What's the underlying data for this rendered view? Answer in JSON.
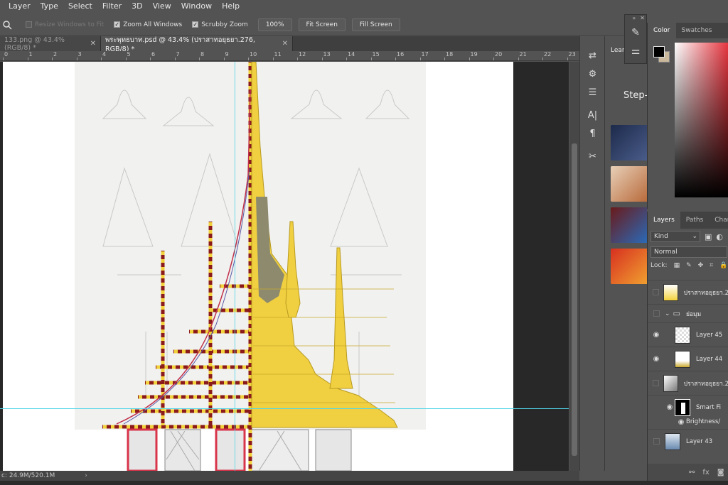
{
  "menu": [
    "Layer",
    "Type",
    "Select",
    "Filter",
    "3D",
    "View",
    "Window",
    "Help"
  ],
  "options": {
    "resize_windows": "Resize Windows to Fit",
    "zoom_all": "Zoom All Windows",
    "scrubby": "Scrubby Zoom",
    "zoom_value": "100%",
    "fit_screen": "Fit Screen",
    "fill_screen": "Fill Screen"
  },
  "tabs": [
    {
      "label": "133.png @ 43.4% (RGB/8) *",
      "active": false
    },
    {
      "label": "พระพุทธบาท.psd @ 43.4% (ปราสาทอยุธยา.276, RGB/8) *",
      "active": true
    }
  ],
  "ruler_ticks": [
    "0",
    "1",
    "2",
    "3",
    "4",
    "5",
    "6",
    "7",
    "8",
    "9",
    "10",
    "11",
    "12",
    "13",
    "14",
    "15",
    "16",
    "17",
    "18",
    "19",
    "20",
    "21",
    "22",
    "23"
  ],
  "status": {
    "doc_size": "c: 24.9M/520.1M"
  },
  "learn_panel": {
    "title": "Learn",
    "step": "Step-b"
  },
  "color_panel": {
    "tabs": [
      "Color",
      "Swatches"
    ],
    "foreground": "#000000",
    "background": "#c8b79a"
  },
  "layers_panel": {
    "tabs": [
      "Layers",
      "Paths",
      "Channe"
    ],
    "filter": "Kind",
    "blend_mode": "Normal",
    "lock_label": "Lock:",
    "layers": [
      {
        "name": "ปราสาทอยุธยา.2",
        "visible": false
      },
      {
        "name": "ย่อมุม",
        "visible": false,
        "group": true
      },
      {
        "name": "Layer 45",
        "visible": true
      },
      {
        "name": "Layer 44",
        "visible": true
      },
      {
        "name": "ปราสาทอยุธยา.2",
        "visible": false
      },
      {
        "name": "Smart Fi",
        "visible": true,
        "mask": true
      },
      {
        "name": "Brightness/",
        "visible": true
      },
      {
        "name": "Layer 43",
        "visible": false
      }
    ]
  },
  "colors": {
    "guide": "#4fd6e8",
    "gold": "#f2d23c",
    "maroon": "#8b1a1a",
    "pillar": "#d8344a"
  }
}
